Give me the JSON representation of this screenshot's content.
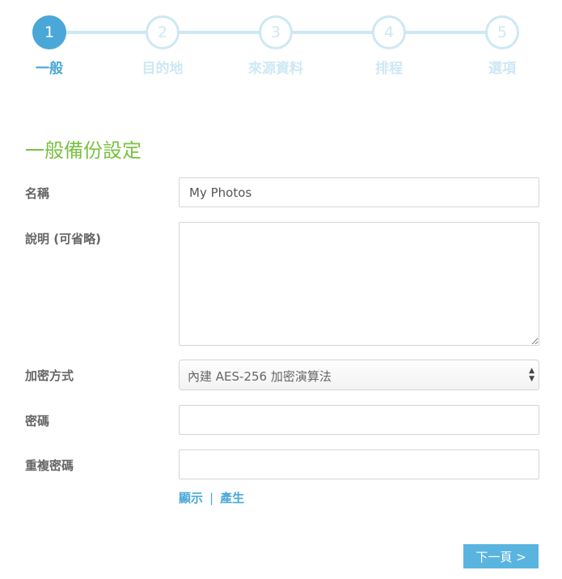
{
  "stepper": {
    "steps": [
      {
        "number": "1",
        "label": "一般",
        "active": true
      },
      {
        "number": "2",
        "label": "目的地",
        "active": false
      },
      {
        "number": "3",
        "label": "來源資料",
        "active": false
      },
      {
        "number": "4",
        "label": "排程",
        "active": false
      },
      {
        "number": "5",
        "label": "選項",
        "active": false
      }
    ],
    "colors": {
      "active": "#4aa8d8",
      "inactive": "#cde8f4"
    }
  },
  "section": {
    "title": "一般備份設定",
    "title_color": "#7ac142"
  },
  "form": {
    "name": {
      "label": "名稱",
      "value": "My Photos"
    },
    "description": {
      "label": "說明 (可省略)",
      "value": ""
    },
    "encryption": {
      "label": "加密方式",
      "selected": "內建 AES-256 加密演算法",
      "arrow_icon": "up-down-arrows-icon"
    },
    "password": {
      "label": "密碼",
      "value": ""
    },
    "confirm_password": {
      "label": "重複密碼",
      "value": ""
    },
    "links": {
      "show": "顯示",
      "separator": "|",
      "generate": "產生"
    }
  },
  "footer": {
    "next_button": "下一頁 >",
    "next_button_color": "#5ab4e0"
  }
}
